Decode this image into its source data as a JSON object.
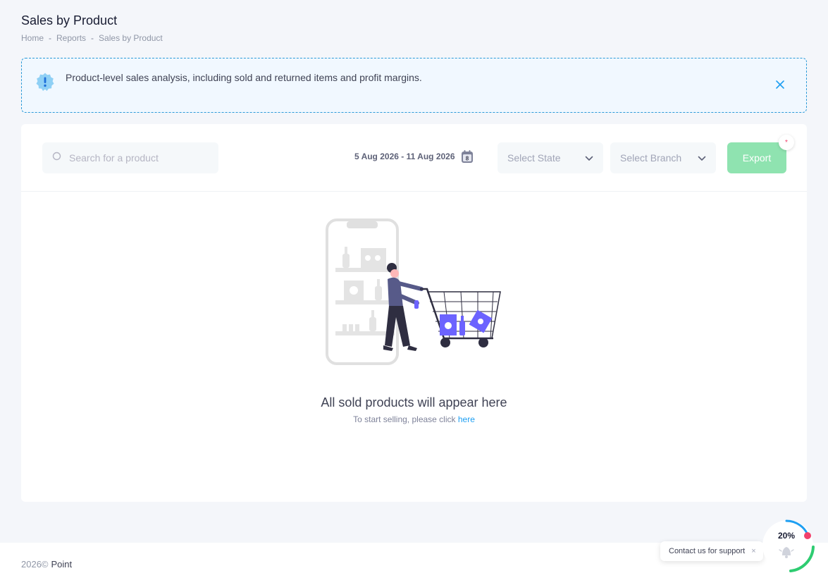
{
  "header": {
    "title": "Sales by Product",
    "breadcrumb": [
      "Home",
      "Reports",
      "Sales by Product"
    ]
  },
  "alert": {
    "text": "Product-level sales analysis, including sold and returned items and profit margins.",
    "close_icon": "close-icon"
  },
  "toolbar": {
    "search_placeholder": "Search for a product",
    "date_range": "5 Aug 2026 - 11 Aug 2026",
    "calendar_day": "8",
    "state_placeholder": "Select State",
    "branch_placeholder": "Select Branch",
    "export_label": "Export",
    "export_badge": "*"
  },
  "empty_state": {
    "title": "All sold products will appear here",
    "subtitle_prefix": "To start selling, please click ",
    "subtitle_link": "here"
  },
  "footer": {
    "year": "2026©",
    "brand": "Point"
  },
  "support": {
    "label": "Contact us for support",
    "close": "×",
    "progress_label": "20%",
    "progress_value": 0.2
  },
  "colors": {
    "accent": "#1e9ff2",
    "export": "#8fe3b0",
    "alert_bg": "#f1f8ff",
    "illustration_accent": "#6c63ff"
  }
}
